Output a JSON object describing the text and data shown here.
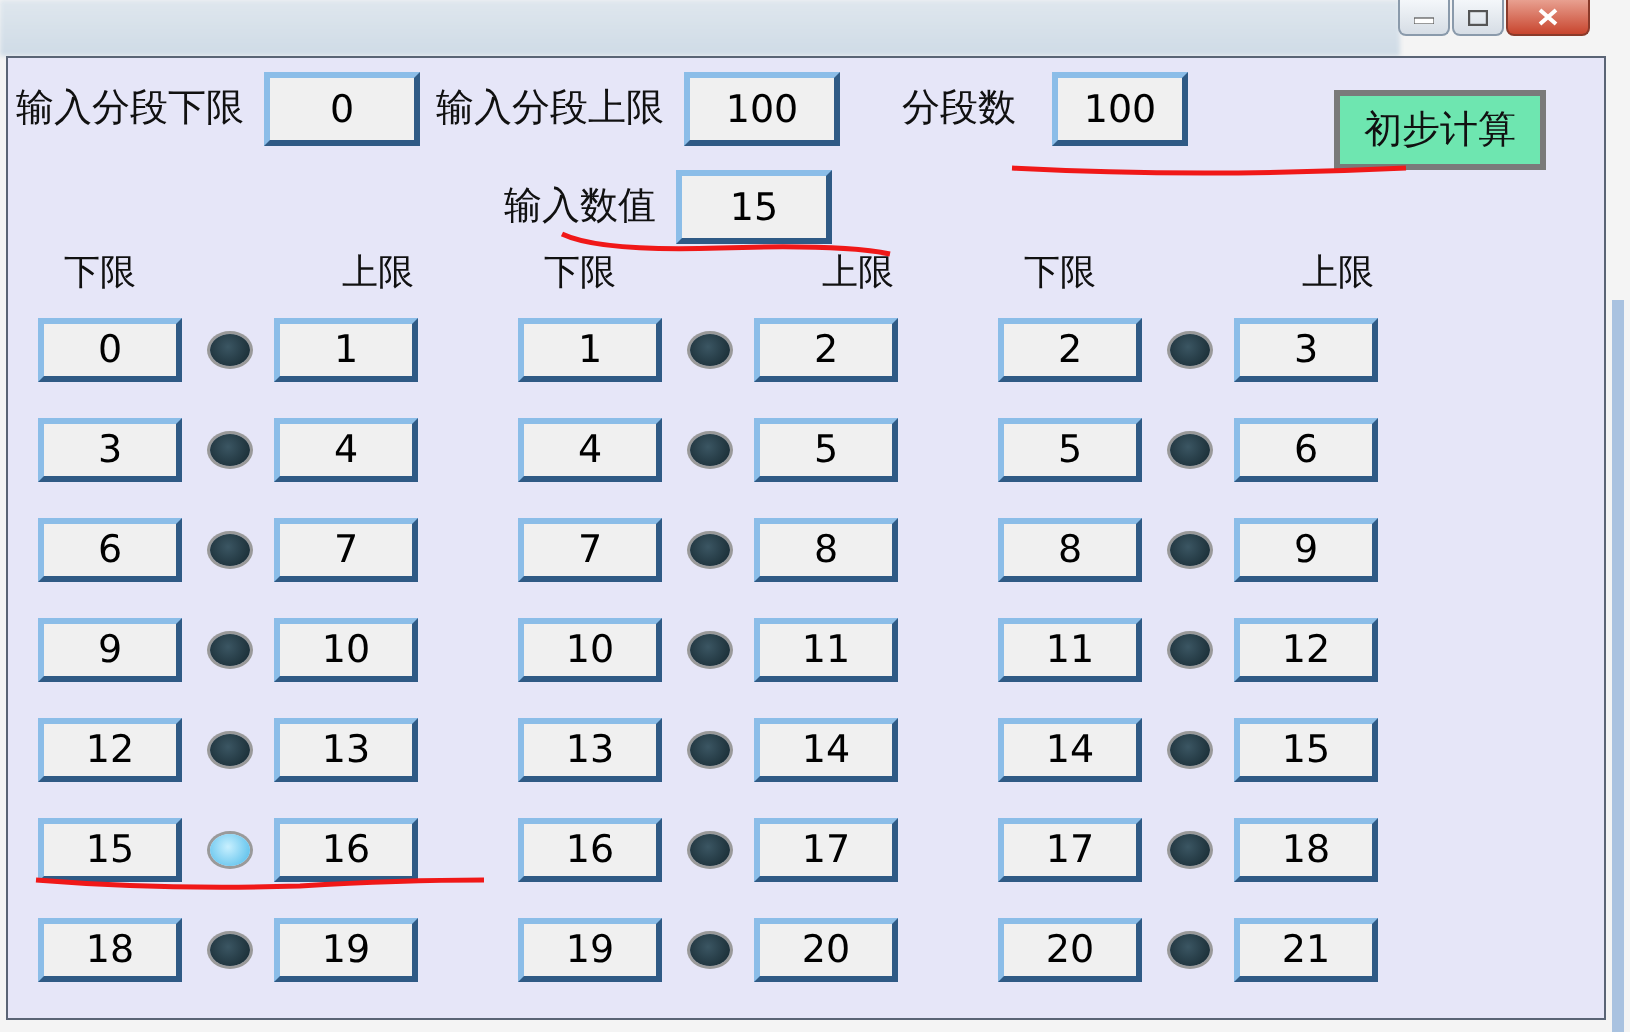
{
  "fields": [
    {
      "label": "输入分段下限",
      "value": "0"
    },
    {
      "label": "输入分段上限",
      "value": "100"
    },
    {
      "label": "分段数",
      "value": "100"
    }
  ],
  "compute_button": "初步计算",
  "input_value": {
    "label": "输入数值",
    "value": "15"
  },
  "groups": [
    {
      "lower_header": "下限",
      "upper_header": "上限",
      "segments": [
        {
          "lower": "0",
          "upper": "1",
          "lit": false
        },
        {
          "lower": "3",
          "upper": "4",
          "lit": false
        },
        {
          "lower": "6",
          "upper": "7",
          "lit": false
        },
        {
          "lower": "9",
          "upper": "10",
          "lit": false
        },
        {
          "lower": "12",
          "upper": "13",
          "lit": false
        },
        {
          "lower": "15",
          "upper": "16",
          "lit": true
        },
        {
          "lower": "18",
          "upper": "19",
          "lit": false
        }
      ]
    },
    {
      "lower_header": "下限",
      "upper_header": "上限",
      "segments": [
        {
          "lower": "1",
          "upper": "2",
          "lit": false
        },
        {
          "lower": "4",
          "upper": "5",
          "lit": false
        },
        {
          "lower": "7",
          "upper": "8",
          "lit": false
        },
        {
          "lower": "10",
          "upper": "11",
          "lit": false
        },
        {
          "lower": "13",
          "upper": "14",
          "lit": false
        },
        {
          "lower": "16",
          "upper": "17",
          "lit": false
        },
        {
          "lower": "19",
          "upper": "20",
          "lit": false
        }
      ]
    },
    {
      "lower_header": "下限",
      "upper_header": "上限",
      "segments": [
        {
          "lower": "2",
          "upper": "3",
          "lit": false
        },
        {
          "lower": "5",
          "upper": "6",
          "lit": false
        },
        {
          "lower": "8",
          "upper": "9",
          "lit": false
        },
        {
          "lower": "11",
          "upper": "12",
          "lit": false
        },
        {
          "lower": "14",
          "upper": "15",
          "lit": false
        },
        {
          "lower": "17",
          "upper": "18",
          "lit": false
        },
        {
          "lower": "20",
          "upper": "21",
          "lit": false
        }
      ]
    }
  ]
}
